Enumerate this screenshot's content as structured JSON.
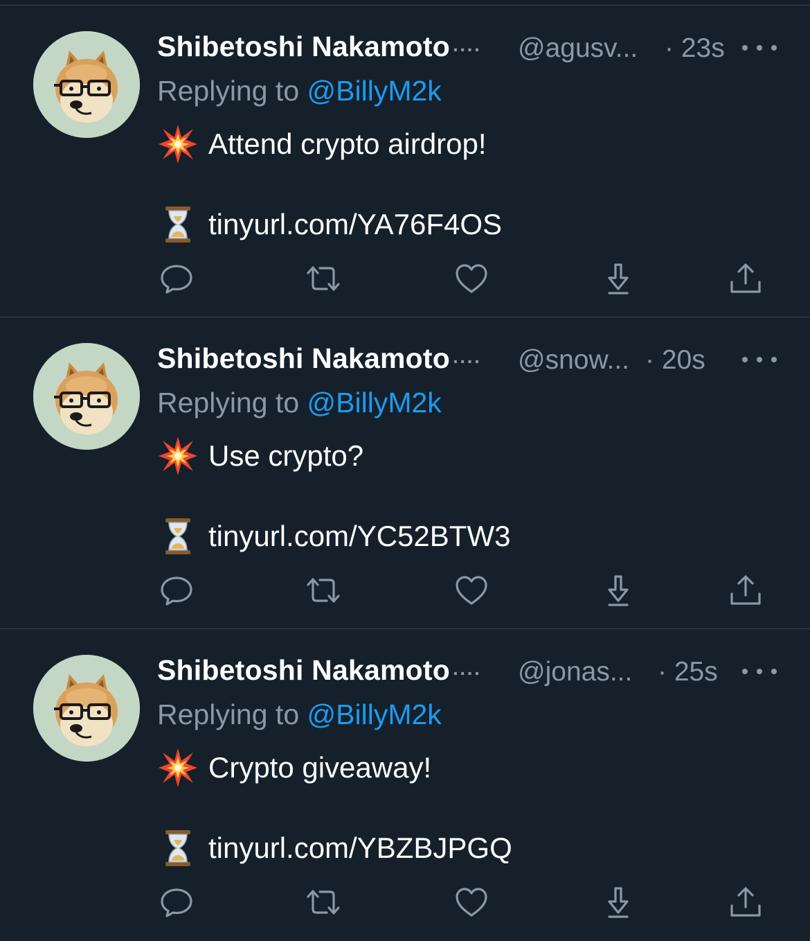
{
  "theme": {
    "background": "#15202b",
    "divider": "#38444d",
    "text_primary": "#ffffff",
    "text_secondary": "#8b98a5",
    "accent": "#1d9bf0"
  },
  "tweets": [
    {
      "author_name": "Shibetoshi Nakamoto",
      "name_overflow": "····",
      "handle": "@agusv...",
      "time_sep": "·",
      "time": "23s",
      "replying_prefix": "Replying to",
      "replying_mention": "@BillyM2k",
      "line1_icon": "collision-emoji",
      "line1_text": "Attend crypto airdrop!",
      "line2_icon": "hourglass-emoji",
      "line2_text": "tinyurl.com/YA76F4OS"
    },
    {
      "author_name": "Shibetoshi Nakamoto",
      "name_overflow": "····",
      "handle": "@snow...",
      "time_sep": "·",
      "time": "20s",
      "replying_prefix": "Replying to",
      "replying_mention": "@BillyM2k",
      "line1_icon": "collision-emoji",
      "line1_text": "Use crypto?",
      "line2_icon": "hourglass-emoji",
      "line2_text": "tinyurl.com/YC52BTW3"
    },
    {
      "author_name": "Shibetoshi Nakamoto",
      "name_overflow": "····",
      "handle": "@jonas...",
      "time_sep": "·",
      "time": "25s",
      "replying_prefix": "Replying to",
      "replying_mention": "@BillyM2k",
      "line1_icon": "collision-emoji",
      "line1_text": "Crypto giveaway!",
      "line2_icon": "hourglass-emoji",
      "line2_text": "tinyurl.com/YBZBJPGQ"
    }
  ],
  "action_icons": [
    "reply-icon",
    "retweet-icon",
    "like-icon",
    "download-icon",
    "share-icon"
  ]
}
